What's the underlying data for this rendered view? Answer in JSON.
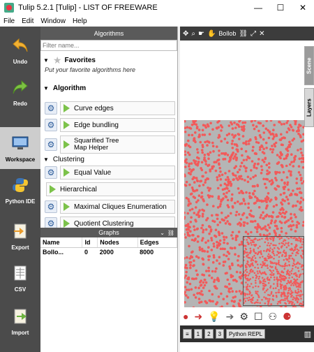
{
  "window": {
    "title": "Tulip 5.2.1 [Tulip]  -  LIST OF FREEWARE",
    "minimize": "—",
    "maximize": "☐",
    "close": "✕"
  },
  "menu": [
    "File",
    "Edit",
    "Window",
    "Help"
  ],
  "sidebar": [
    {
      "label": "Undo",
      "icon": "undo-arrow-icon"
    },
    {
      "label": "Redo",
      "icon": "redo-arrow-icon"
    },
    {
      "label": "Workspace",
      "icon": "workspace-icon"
    },
    {
      "label": "Python IDE",
      "icon": "python-icon"
    },
    {
      "label": "Export",
      "icon": "export-icon"
    },
    {
      "label": "CSV",
      "icon": "csv-icon"
    },
    {
      "label": "Import",
      "icon": "import-icon"
    }
  ],
  "algorithms": {
    "header": "Algorithms",
    "filter_placeholder": "Filter name...",
    "favorites_label": "Favorites",
    "favorites_hint": "Put your favorite algorithms here",
    "algorithm_label": "Algorithm",
    "items": [
      "Curve edges",
      "Edge bundling",
      "Squarified Tree\nMap Helper"
    ],
    "clustering_label": "Clustering",
    "clustering_items": [
      "Equal Value",
      "Hierarchical",
      "Maximal Cliques Enumeration",
      "Quotient Clustering"
    ]
  },
  "graphs": {
    "header": "Graphs",
    "columns": [
      "Name",
      "Id",
      "Nodes",
      "Edges"
    ],
    "rows": [
      {
        "name": "Bollo...",
        "id": "0",
        "nodes": "2000",
        "edges": "8000"
      }
    ]
  },
  "view": {
    "toolbar_label": "Bollob",
    "tabs": [
      "Scene",
      "Layers"
    ],
    "status": [
      "1",
      "2",
      "3",
      "Python REPL"
    ],
    "colors": {
      "node": "#f25a5a",
      "edge": "#b5b5b5"
    }
  }
}
